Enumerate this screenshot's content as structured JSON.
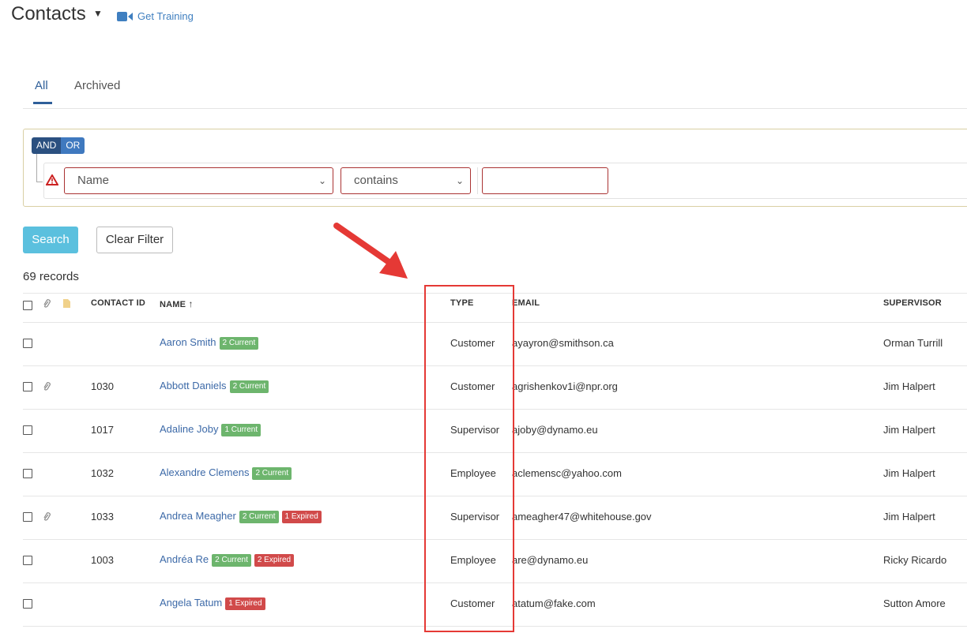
{
  "header": {
    "title": "Contacts",
    "training_label": "Get Training"
  },
  "tabs": [
    {
      "label": "All"
    },
    {
      "label": "Archived"
    }
  ],
  "filter": {
    "and_label": "AND",
    "or_label": "OR",
    "field_value": "Name",
    "operator_value": "contains",
    "value": ""
  },
  "buttons": {
    "search": "Search",
    "clear": "Clear Filter"
  },
  "records_count": "69 records",
  "table": {
    "columns": {
      "contact_id": "CONTACT ID",
      "name": "NAME",
      "type": "TYPE",
      "email": "EMAIL",
      "supervisor": "SUPERVISOR"
    },
    "sort_indicator": "↑",
    "rows": [
      {
        "id": "",
        "name": "Aaron Smith",
        "badges": [
          {
            "text": "2 Current",
            "kind": "green"
          }
        ],
        "type": "Customer",
        "email": "ayayron@smithson.ca",
        "supervisor": "Orman Turrill",
        "attachment": false
      },
      {
        "id": "1030",
        "name": "Abbott Daniels",
        "badges": [
          {
            "text": "2 Current",
            "kind": "green"
          }
        ],
        "type": "Customer",
        "email": "agrishenkov1i@npr.org",
        "supervisor": "Jim Halpert",
        "attachment": true
      },
      {
        "id": "1017",
        "name": "Adaline Joby",
        "badges": [
          {
            "text": "1 Current",
            "kind": "green"
          }
        ],
        "type": "Supervisor",
        "email": "ajoby@dynamo.eu",
        "supervisor": "Jim Halpert",
        "attachment": false
      },
      {
        "id": "1032",
        "name": "Alexandre Clemens",
        "badges": [
          {
            "text": "2 Current",
            "kind": "green"
          }
        ],
        "type": "Employee",
        "email": "aclemensc@yahoo.com",
        "supervisor": "Jim Halpert",
        "attachment": false
      },
      {
        "id": "1033",
        "name": "Andrea Meagher",
        "badges": [
          {
            "text": "2 Current",
            "kind": "green"
          },
          {
            "text": "1 Expired",
            "kind": "red"
          }
        ],
        "type": "Supervisor",
        "email": "ameagher47@whitehouse.gov",
        "supervisor": "Jim Halpert",
        "attachment": true
      },
      {
        "id": "1003",
        "name": "Andréa Re",
        "badges": [
          {
            "text": "2 Current",
            "kind": "green"
          },
          {
            "text": "2 Expired",
            "kind": "red"
          }
        ],
        "type": "Employee",
        "email": "are@dynamo.eu",
        "supervisor": "Ricky Ricardo",
        "attachment": false
      },
      {
        "id": "",
        "name": "Angela Tatum",
        "badges": [
          {
            "text": "1 Expired",
            "kind": "red"
          }
        ],
        "type": "Customer",
        "email": "atatum@fake.com",
        "supervisor": "Sutton Amore",
        "attachment": false
      }
    ]
  },
  "colors": {
    "accent": "#2f5f99",
    "link": "#3d6aa8",
    "search_button": "#5bc0de",
    "badge_current": "#6db56d",
    "badge_expired": "#d14a4a",
    "annotation": "#e53935"
  }
}
